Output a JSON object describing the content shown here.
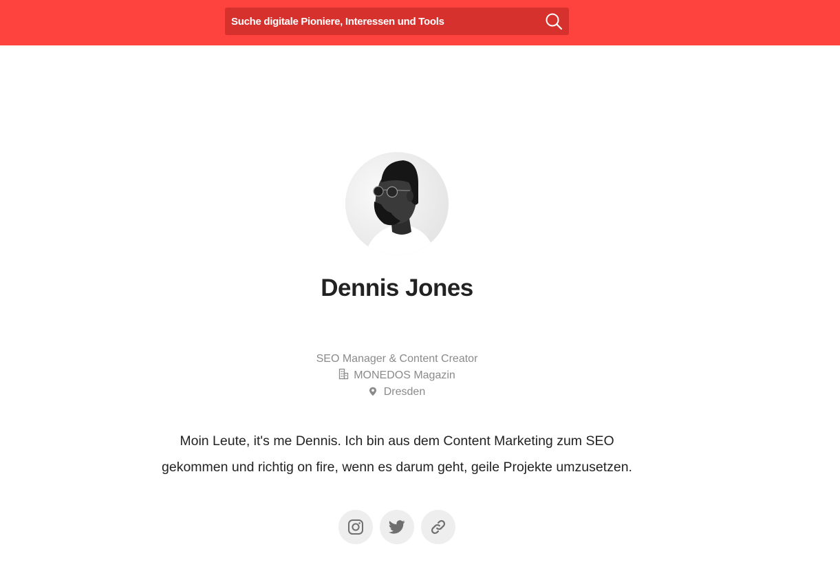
{
  "search": {
    "placeholder": "Suche digitale Pioniere, Interessen und Tools",
    "icon": "search-icon"
  },
  "colors": {
    "topbar": "#fe423d",
    "search_field": "#d7312e",
    "meta_text": "#8a8a8a",
    "social_bg": "#eeeeee"
  },
  "profile": {
    "name": "Dennis Jones",
    "role": "SEO Manager & Content Creator",
    "company": "MONEDOS Magazin",
    "location": "Dresden",
    "bio_line1": "Moin Leute, it's me Dennis. Ich bin aus dem Content Marketing zum SEO",
    "bio_line2": "gekommen und richtig on fire, wenn es darum geht, geile Projekte umzusetzen."
  },
  "social_links": [
    {
      "icon": "instagram-icon"
    },
    {
      "icon": "twitter-icon"
    },
    {
      "icon": "link-icon"
    }
  ]
}
